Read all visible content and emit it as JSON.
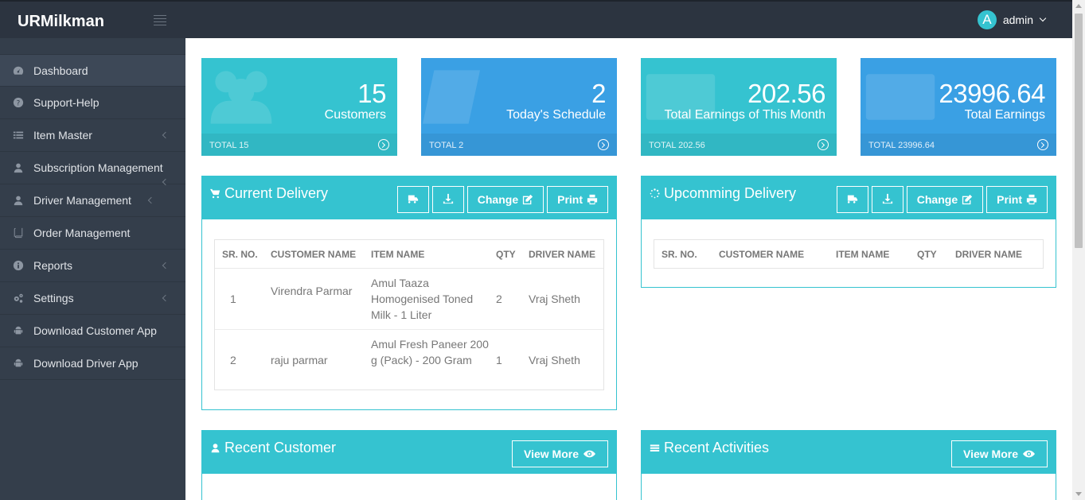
{
  "app": {
    "brand": "URMilkman"
  },
  "header": {
    "user_initial": "A",
    "user_name": "admin"
  },
  "sidebar": {
    "items": [
      {
        "label": "Dashboard",
        "icon": "dashboard-icon"
      },
      {
        "label": "Support-Help",
        "icon": "question-icon"
      },
      {
        "label": "Item Master",
        "icon": "list-icon"
      },
      {
        "label": "Subscription Management",
        "icon": "user-icon"
      },
      {
        "label": "Driver Management",
        "icon": "user-icon"
      },
      {
        "label": "Order Management",
        "icon": "book-icon"
      },
      {
        "label": "Reports",
        "icon": "info-icon"
      },
      {
        "label": "Settings",
        "icon": "gears-icon"
      },
      {
        "label": "Download Customer App",
        "icon": "android-icon"
      },
      {
        "label": "Download Driver App",
        "icon": "android-icon"
      }
    ]
  },
  "stats": [
    {
      "value": "15",
      "label": "Customers",
      "footer": "TOTAL 15",
      "color": "#35c3d0"
    },
    {
      "value": "2",
      "label": "Today's Schedule",
      "footer": "TOTAL 2",
      "color": "#3aa0e4"
    },
    {
      "value": "202.56",
      "label": "Total Earnings of This Month",
      "footer": "TOTAL 202.56",
      "color": "#35c3d0"
    },
    {
      "value": "23996.64",
      "label": "Total Earnings",
      "footer": "TOTAL 23996.64",
      "color": "#3aa0e4"
    }
  ],
  "current_delivery": {
    "title": "Current Delivery",
    "change_label": "Change",
    "print_label": "Print",
    "columns": [
      "SR. NO.",
      "CUSTOMER NAME",
      "ITEM NAME",
      "QTY",
      "DRIVER NAME"
    ],
    "rows": [
      {
        "sr": "1",
        "customer": "Virendra Parmar",
        "item": "Amul Taaza Homogenised Toned Milk - 1 Liter",
        "qty": "2",
        "driver": "Vraj Sheth"
      },
      {
        "sr": "2",
        "customer": "raju parmar",
        "item": "Amul Fresh Paneer 200 g (Pack) - 200 Gram",
        "qty": "1",
        "driver": "Vraj Sheth"
      }
    ]
  },
  "upcoming_delivery": {
    "title": "Upcomming Delivery",
    "change_label": "Change",
    "print_label": "Print",
    "columns": [
      "SR. NO.",
      "CUSTOMER NAME",
      "ITEM NAME",
      "QTY",
      "DRIVER NAME"
    ]
  },
  "recent_customer": {
    "title": "Recent Customer",
    "view_more_label": "View More"
  },
  "recent_activities": {
    "title": "Recent Activities",
    "view_more_label": "View More"
  },
  "theme": {
    "accent": "#35c3d0",
    "blue": "#3aa0e4",
    "header_bg": "#2c3440",
    "sidebar_bg": "#343e4b"
  }
}
